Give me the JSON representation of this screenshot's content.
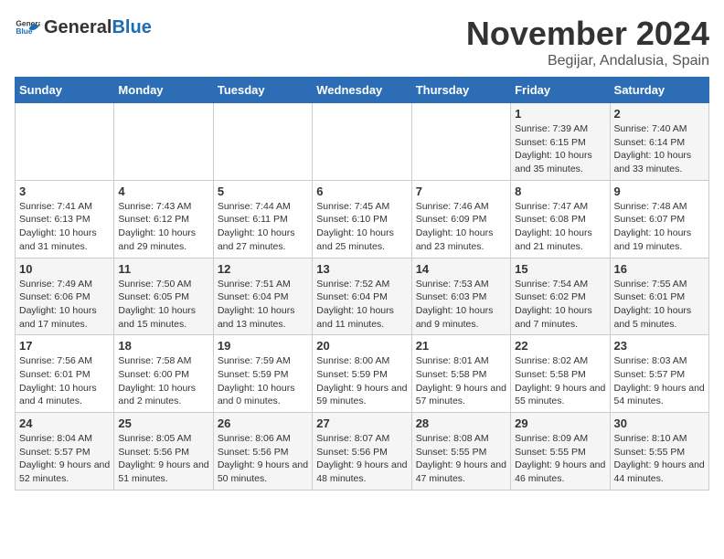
{
  "logo": {
    "general": "General",
    "blue": "Blue"
  },
  "title": "November 2024",
  "subtitle": "Begijar, Andalusia, Spain",
  "headers": [
    "Sunday",
    "Monday",
    "Tuesday",
    "Wednesday",
    "Thursday",
    "Friday",
    "Saturday"
  ],
  "weeks": [
    [
      {
        "day": "",
        "info": ""
      },
      {
        "day": "",
        "info": ""
      },
      {
        "day": "",
        "info": ""
      },
      {
        "day": "",
        "info": ""
      },
      {
        "day": "",
        "info": ""
      },
      {
        "day": "1",
        "info": "Sunrise: 7:39 AM\nSunset: 6:15 PM\nDaylight: 10 hours and 35 minutes."
      },
      {
        "day": "2",
        "info": "Sunrise: 7:40 AM\nSunset: 6:14 PM\nDaylight: 10 hours and 33 minutes."
      }
    ],
    [
      {
        "day": "3",
        "info": "Sunrise: 7:41 AM\nSunset: 6:13 PM\nDaylight: 10 hours and 31 minutes."
      },
      {
        "day": "4",
        "info": "Sunrise: 7:43 AM\nSunset: 6:12 PM\nDaylight: 10 hours and 29 minutes."
      },
      {
        "day": "5",
        "info": "Sunrise: 7:44 AM\nSunset: 6:11 PM\nDaylight: 10 hours and 27 minutes."
      },
      {
        "day": "6",
        "info": "Sunrise: 7:45 AM\nSunset: 6:10 PM\nDaylight: 10 hours and 25 minutes."
      },
      {
        "day": "7",
        "info": "Sunrise: 7:46 AM\nSunset: 6:09 PM\nDaylight: 10 hours and 23 minutes."
      },
      {
        "day": "8",
        "info": "Sunrise: 7:47 AM\nSunset: 6:08 PM\nDaylight: 10 hours and 21 minutes."
      },
      {
        "day": "9",
        "info": "Sunrise: 7:48 AM\nSunset: 6:07 PM\nDaylight: 10 hours and 19 minutes."
      }
    ],
    [
      {
        "day": "10",
        "info": "Sunrise: 7:49 AM\nSunset: 6:06 PM\nDaylight: 10 hours and 17 minutes."
      },
      {
        "day": "11",
        "info": "Sunrise: 7:50 AM\nSunset: 6:05 PM\nDaylight: 10 hours and 15 minutes."
      },
      {
        "day": "12",
        "info": "Sunrise: 7:51 AM\nSunset: 6:04 PM\nDaylight: 10 hours and 13 minutes."
      },
      {
        "day": "13",
        "info": "Sunrise: 7:52 AM\nSunset: 6:04 PM\nDaylight: 10 hours and 11 minutes."
      },
      {
        "day": "14",
        "info": "Sunrise: 7:53 AM\nSunset: 6:03 PM\nDaylight: 10 hours and 9 minutes."
      },
      {
        "day": "15",
        "info": "Sunrise: 7:54 AM\nSunset: 6:02 PM\nDaylight: 10 hours and 7 minutes."
      },
      {
        "day": "16",
        "info": "Sunrise: 7:55 AM\nSunset: 6:01 PM\nDaylight: 10 hours and 5 minutes."
      }
    ],
    [
      {
        "day": "17",
        "info": "Sunrise: 7:56 AM\nSunset: 6:01 PM\nDaylight: 10 hours and 4 minutes."
      },
      {
        "day": "18",
        "info": "Sunrise: 7:58 AM\nSunset: 6:00 PM\nDaylight: 10 hours and 2 minutes."
      },
      {
        "day": "19",
        "info": "Sunrise: 7:59 AM\nSunset: 5:59 PM\nDaylight: 10 hours and 0 minutes."
      },
      {
        "day": "20",
        "info": "Sunrise: 8:00 AM\nSunset: 5:59 PM\nDaylight: 9 hours and 59 minutes."
      },
      {
        "day": "21",
        "info": "Sunrise: 8:01 AM\nSunset: 5:58 PM\nDaylight: 9 hours and 57 minutes."
      },
      {
        "day": "22",
        "info": "Sunrise: 8:02 AM\nSunset: 5:58 PM\nDaylight: 9 hours and 55 minutes."
      },
      {
        "day": "23",
        "info": "Sunrise: 8:03 AM\nSunset: 5:57 PM\nDaylight: 9 hours and 54 minutes."
      }
    ],
    [
      {
        "day": "24",
        "info": "Sunrise: 8:04 AM\nSunset: 5:57 PM\nDaylight: 9 hours and 52 minutes."
      },
      {
        "day": "25",
        "info": "Sunrise: 8:05 AM\nSunset: 5:56 PM\nDaylight: 9 hours and 51 minutes."
      },
      {
        "day": "26",
        "info": "Sunrise: 8:06 AM\nSunset: 5:56 PM\nDaylight: 9 hours and 50 minutes."
      },
      {
        "day": "27",
        "info": "Sunrise: 8:07 AM\nSunset: 5:56 PM\nDaylight: 9 hours and 48 minutes."
      },
      {
        "day": "28",
        "info": "Sunrise: 8:08 AM\nSunset: 5:55 PM\nDaylight: 9 hours and 47 minutes."
      },
      {
        "day": "29",
        "info": "Sunrise: 8:09 AM\nSunset: 5:55 PM\nDaylight: 9 hours and 46 minutes."
      },
      {
        "day": "30",
        "info": "Sunrise: 8:10 AM\nSunset: 5:55 PM\nDaylight: 9 hours and 44 minutes."
      }
    ]
  ]
}
